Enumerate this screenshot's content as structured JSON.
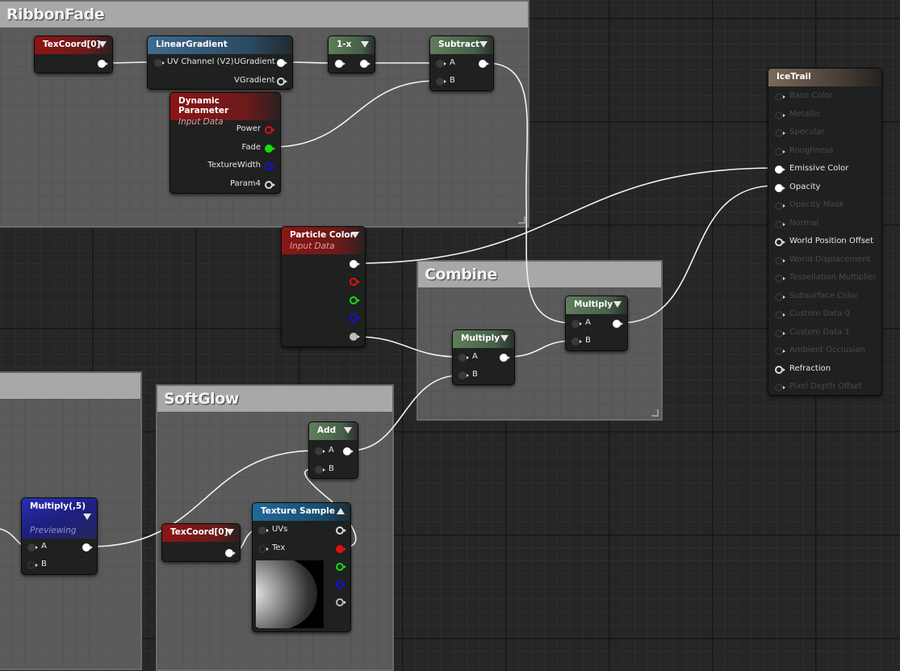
{
  "comments": {
    "ribbon_fade": "RibbonFade",
    "combine": "Combine",
    "soft_glow": "SoftGlow",
    "left_group": ""
  },
  "nodes": {
    "texcoord1": {
      "title": "TexCoord[0]"
    },
    "linear_gradient": {
      "title": "LinearGradient",
      "inputs": [
        "UV Channel (V2)"
      ],
      "outputs": [
        "UGradient",
        "VGradient"
      ]
    },
    "one_minus": {
      "title": "1-x"
    },
    "subtract": {
      "title": "Subtract",
      "inputs": [
        "A",
        "B"
      ]
    },
    "dynamic_parameter": {
      "title": "Dynamic Parameter",
      "subtitle": "Input Data",
      "outputs": [
        "Power",
        "Fade",
        "TextureWidth",
        "Param4"
      ]
    },
    "particle_color": {
      "title": "Particle Color",
      "subtitle": "Input Data"
    },
    "multiply_left": {
      "title": "Multiply",
      "inputs": [
        "A",
        "B"
      ]
    },
    "multiply_right": {
      "title": "Multiply",
      "inputs": [
        "A",
        "B"
      ]
    },
    "add": {
      "title": "Add",
      "inputs": [
        "A",
        "B"
      ]
    },
    "multiply5": {
      "title": "Multiply(,5)",
      "subtitle": "Previewing",
      "inputs": [
        "A",
        "B"
      ]
    },
    "texcoord2": {
      "title": "TexCoord[0]"
    },
    "texture_sample": {
      "title": "Texture Sample",
      "inputs": [
        "UVs",
        "Tex"
      ]
    },
    "ice_trail": {
      "title": "IceTrail",
      "inputs": [
        {
          "label": "Base Color",
          "active": false
        },
        {
          "label": "Metallic",
          "active": false
        },
        {
          "label": "Specular",
          "active": false
        },
        {
          "label": "Roughness",
          "active": false
        },
        {
          "label": "Emissive Color",
          "active": true,
          "connected": true
        },
        {
          "label": "Opacity",
          "active": true,
          "connected": true
        },
        {
          "label": "Opacity Mask",
          "active": false
        },
        {
          "label": "Normal",
          "active": false
        },
        {
          "label": "World Position Offset",
          "active": true
        },
        {
          "label": "World Displacement",
          "active": false
        },
        {
          "label": "Tessellation Multiplier",
          "active": false
        },
        {
          "label": "Subsurface Color",
          "active": false
        },
        {
          "label": "Custom Data 0",
          "active": false
        },
        {
          "label": "Custom Data 1",
          "active": false
        },
        {
          "label": "Ambient Occlusion",
          "active": false
        },
        {
          "label": "Refraction",
          "active": true
        },
        {
          "label": "Pixel Depth Offset",
          "active": false
        }
      ]
    }
  },
  "colors": {
    "red_pin": "#e01010",
    "green_pin": "#10e010",
    "blue_pin": "#1010e0",
    "wire": "#f2f2f2"
  }
}
